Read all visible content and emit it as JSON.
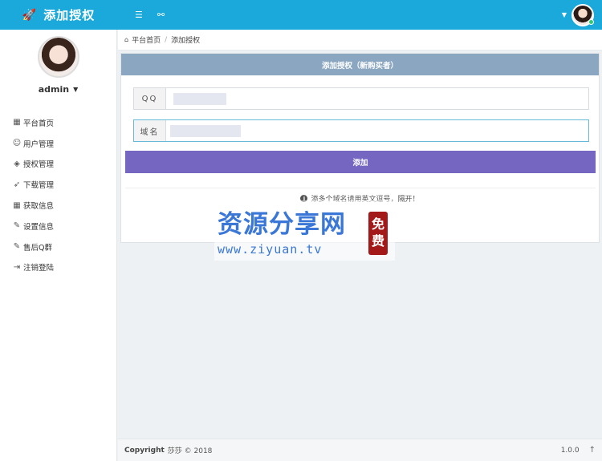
{
  "header": {
    "brand_icon": "rocket-icon",
    "brand_title": "添加授权",
    "icon1": "list-icon",
    "icon2": "user-icon",
    "avatar_alt": "admin avatar"
  },
  "sidebar": {
    "username": "admin",
    "items": [
      {
        "icon": "grid-icon",
        "label": "平台首页"
      },
      {
        "icon": "user-icon",
        "label": "用户管理"
      },
      {
        "icon": "layers-icon",
        "label": "授权管理"
      },
      {
        "icon": "rocket-icon",
        "label": "下载管理"
      },
      {
        "icon": "grid-icon",
        "label": "获取信息"
      },
      {
        "icon": "edit-icon",
        "label": "设置信息"
      },
      {
        "icon": "edit-icon",
        "label": "售后Q群"
      },
      {
        "icon": "logout-icon",
        "label": "注销登陆"
      }
    ]
  },
  "breadcrumb": {
    "home": "平台首页",
    "separator": "/",
    "current": "添加授权"
  },
  "form": {
    "title": "添加授权（新购买者）",
    "qq_label": "QQ",
    "qq_value": "",
    "domain_label": "域名",
    "domain_value": "",
    "submit_label": "添加",
    "hint": "添多个域名请用英文逗号，隔开！"
  },
  "watermark": {
    "title": "资源分享网",
    "url": "www.ziyuan.tv",
    "seal_top": "免",
    "seal_bottom": "费"
  },
  "footer": {
    "copyright_label": "Copyright",
    "copyright_rest": "莎莎 © 2018",
    "version": "1.0.0"
  },
  "colors": {
    "topbar": "#1aa9da",
    "panel_head": "#8aa6c1",
    "button": "#7566c2"
  }
}
